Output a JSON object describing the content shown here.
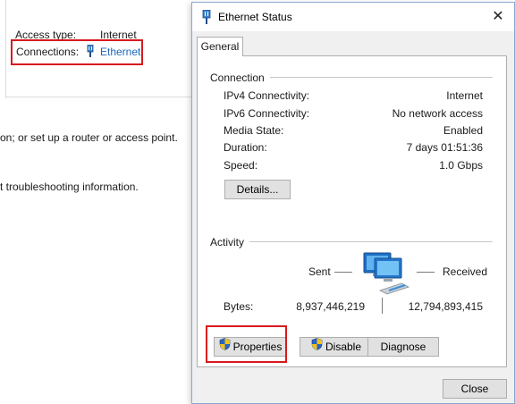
{
  "background": {
    "access_type_label": "Access type:",
    "access_type_value": "Internet",
    "connections_label": "Connections:",
    "connection_link": "Ethernet",
    "line1": "on; or set up a router or access point.",
    "line2": "t troubleshooting information."
  },
  "dialog": {
    "title": "Ethernet Status",
    "close_glyph": "✕",
    "tab_general": "General",
    "connection_group": "Connection",
    "rows": [
      {
        "label": "IPv4 Connectivity:",
        "value": "Internet"
      },
      {
        "label": "IPv6 Connectivity:",
        "value": "No network access"
      },
      {
        "label": "Media State:",
        "value": "Enabled"
      },
      {
        "label": "Duration:",
        "value": "7 days 01:51:36"
      },
      {
        "label": "Speed:",
        "value": "1.0 Gbps"
      }
    ],
    "details_button": "Details...",
    "activity_group": "Activity",
    "sent_label": "Sent",
    "received_label": "Received",
    "bytes_label": "Bytes:",
    "bytes_sent": "8,937,446,219",
    "bytes_received": "12,794,893,415",
    "properties_button": "Properties",
    "disable_button": "Disable",
    "diagnose_button": "Diagnose",
    "close_button": "Close"
  },
  "colors": {
    "highlight": "#d9191f",
    "link": "#1e66b8"
  }
}
